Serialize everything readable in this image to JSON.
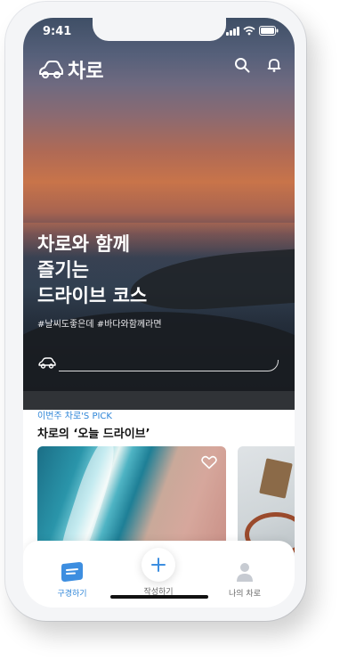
{
  "status": {
    "time": "9:41"
  },
  "app": {
    "logo_text": "차로"
  },
  "hero": {
    "title_lines": [
      "차로와 함께",
      "즐기는",
      "드라이브 코스"
    ],
    "hashtags": "#날씨도좋은데 #바다와함께라면"
  },
  "pick": {
    "kicker": "이번주 차로'S PICK",
    "title": "차로의 ‘오늘 드라이브’"
  },
  "tabs": [
    {
      "label": "구경하기",
      "icon": "browse-icon",
      "active": true
    },
    {
      "label": "작성하기",
      "icon": "plus-icon",
      "active": false
    },
    {
      "label": "나의 차로",
      "icon": "profile-icon",
      "active": false
    }
  ],
  "colors": {
    "accent": "#2f86d8",
    "hero_sunset": "#c8744a"
  }
}
